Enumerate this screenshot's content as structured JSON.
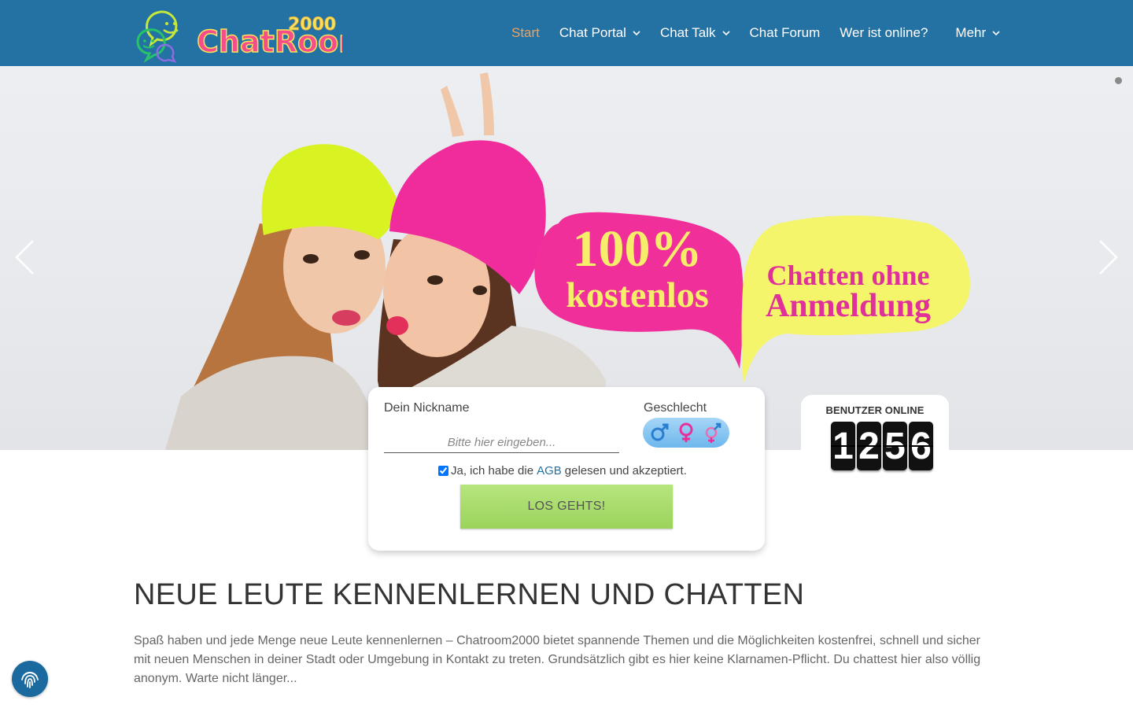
{
  "logo": {
    "text": "ChatRoom",
    "suffix": "2000"
  },
  "nav": {
    "items": [
      {
        "label": "Start",
        "active": true,
        "dropdown": false
      },
      {
        "label": "Chat Portal",
        "active": false,
        "dropdown": true
      },
      {
        "label": "Chat Talk",
        "active": false,
        "dropdown": true
      },
      {
        "label": "Chat Forum",
        "active": false,
        "dropdown": false
      },
      {
        "label": "Wer ist online?",
        "active": false,
        "dropdown": false
      }
    ],
    "more_label": "Mehr"
  },
  "hero": {
    "bubble_pink_big": "100%",
    "bubble_pink_mid": "kostenlos",
    "bubble_yellow_l1": "Chatten ohne",
    "bubble_yellow_l2": "Anmeldung"
  },
  "login": {
    "nick_label": "Dein Nickname",
    "nick_placeholder": "Bitte hier eingeben...",
    "gender_label": "Geschlecht",
    "gender_icons": [
      "male-icon",
      "female-icon",
      "transgender-icon"
    ],
    "agb_prefix": "Ja, ich habe die",
    "agb_link": "AGB",
    "agb_suffix": "gelesen und akzeptiert.",
    "agb_checked": true,
    "submit_label": "LOS GEHTS!"
  },
  "online": {
    "label": "BENUTZER ONLINE",
    "digits": [
      "1",
      "2",
      "5",
      "6"
    ]
  },
  "content": {
    "title": "NEUE LEUTE KENNENLERNEN UND CHATTEN",
    "intro": "Spaß haben und jede Menge neue Leute kennenlernen – Chatroom2000 bietet spannende Themen und die Möglichkeiten kostenfrei, schnell und sicher mit neuen Menschen in deiner Stadt oder Umgebung in Kontakt zu treten. Grundsätzlich gibt es hier keine Klarnamen-Pflicht. Du chattest hier also völlig anonym. Warte nicht länger..."
  },
  "colors": {
    "header_bg": "#2471a3",
    "nav_active": "#f0a25a",
    "bubble_pink": "#f02f9a",
    "bubble_yellow": "#f4f56a",
    "button_green": "#a6db6b"
  }
}
